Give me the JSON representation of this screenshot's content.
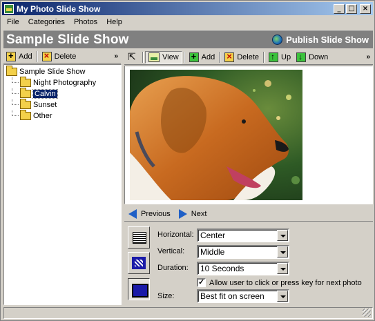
{
  "window": {
    "title": "My Photo Slide Show"
  },
  "menu": [
    "File",
    "Categories",
    "Photos",
    "Help"
  ],
  "banner": {
    "title": "Sample Slide Show",
    "publish_label": "Publish Slide Show"
  },
  "left_toolbar": {
    "add_label": "Add",
    "delete_label": "Delete"
  },
  "tree": {
    "root": "Sample Slide Show",
    "children": [
      "Night Photography",
      "Calvin",
      "Sunset",
      "Other"
    ],
    "selected": "Calvin"
  },
  "right_toolbar": {
    "view_label": "View",
    "add_label": "Add",
    "delete_label": "Delete",
    "up_label": "Up",
    "down_label": "Down"
  },
  "nav": {
    "previous_label": "Previous",
    "next_label": "Next"
  },
  "settings": {
    "horizontal": {
      "label": "Horizontal:",
      "value": "Center"
    },
    "vertical": {
      "label": "Vertical:",
      "value": "Middle"
    },
    "duration": {
      "label": "Duration:",
      "value": "10 Seconds"
    },
    "allow_click": {
      "label": "Allow user to click or press key for next photo",
      "checked": true
    },
    "size": {
      "label": "Size:",
      "value": "Best fit on screen"
    }
  },
  "colors": {
    "titlebar": "#0a246a",
    "banner": "#808080",
    "selection": "#0a246a",
    "nav_arrow": "#1f5fc6"
  }
}
